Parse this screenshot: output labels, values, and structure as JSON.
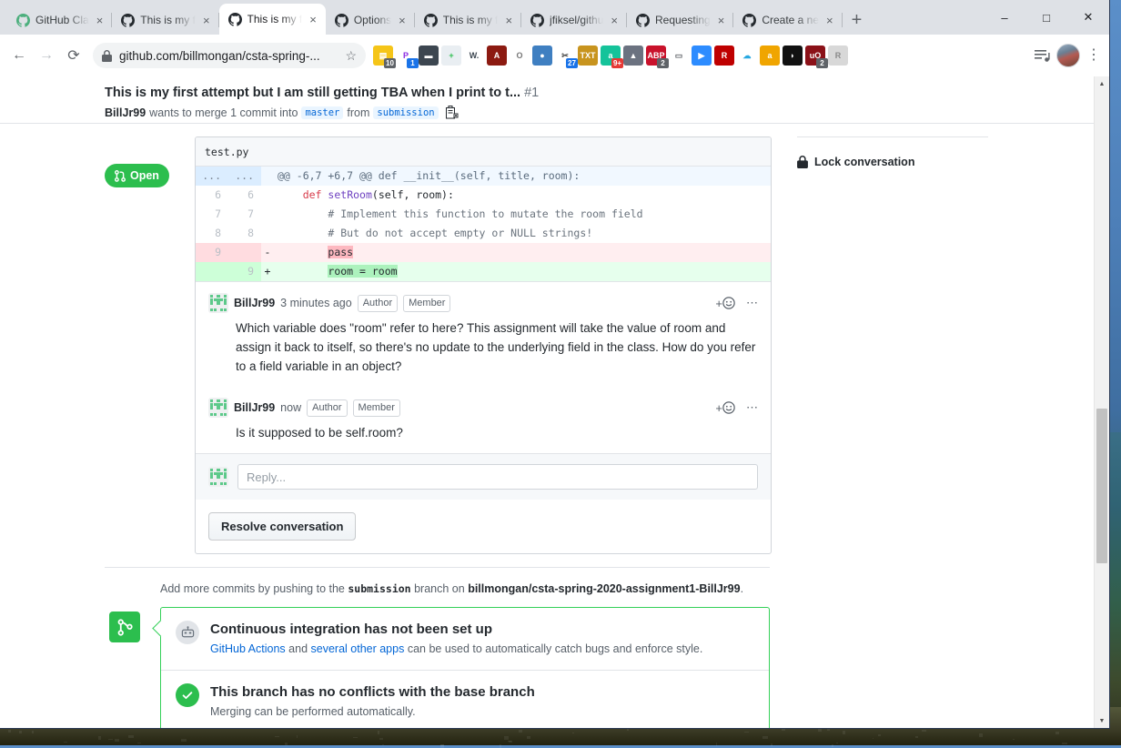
{
  "browser": {
    "tabs": [
      {
        "title": "GitHub Cla",
        "active": false
      },
      {
        "title": "This is my f",
        "active": false
      },
      {
        "title": "This is my f",
        "active": true
      },
      {
        "title": "Options",
        "active": false
      },
      {
        "title": "This is my f",
        "active": false
      },
      {
        "title": "jfiksel/githu",
        "active": false
      },
      {
        "title": "Requesting",
        "active": false
      },
      {
        "title": "Create a ne",
        "active": false
      }
    ],
    "new_tab_label": "+",
    "tab_close_label": "×",
    "window_controls": {
      "minimize": "–",
      "maximize": "□",
      "close": "✕"
    },
    "nav": {
      "back": "←",
      "forward": "→",
      "reload": "⟳"
    },
    "omnibox": {
      "lock_icon": "lock-icon",
      "url": "github.com/billmongan/csta-spring-...",
      "star": "☆"
    },
    "extensions": [
      {
        "name": "notes-extension",
        "glyph": "▤",
        "bg": "#f5c518",
        "badge": "10",
        "badge_color": "gray"
      },
      {
        "name": "pocket-extension",
        "glyph": "P",
        "bg": "#ffffff",
        "fg": "#8a2be2",
        "badge": "1",
        "badge_color": "blue"
      },
      {
        "name": "screenshot-extension",
        "glyph": "▬",
        "bg": "#3c4650",
        "badge": "",
        "badge_color": ""
      },
      {
        "name": "add-page-extension",
        "glyph": "+",
        "bg": "#e9eef2",
        "fg": "#2cbe4e",
        "badge": "",
        "badge_color": ""
      },
      {
        "name": "wikipedia-extension",
        "glyph": "W.",
        "bg": "#ffffff",
        "fg": "#3c4650",
        "badge": "",
        "badge_color": ""
      },
      {
        "name": "adobe-acrobat-extension",
        "glyph": "A",
        "bg": "#8c1a11",
        "badge": "",
        "badge_color": ""
      },
      {
        "name": "opera-extension",
        "glyph": "O",
        "bg": "#ffffff",
        "fg": "#777",
        "badge": "",
        "badge_color": ""
      },
      {
        "name": "globe-extension",
        "glyph": "●",
        "bg": "#3f7fc1",
        "badge": "",
        "badge_color": ""
      },
      {
        "name": "clipper-extension",
        "glyph": "✂",
        "bg": "#ffffff",
        "fg": "#444",
        "badge": "27",
        "badge_color": "blue"
      },
      {
        "name": "txt-extension",
        "glyph": "TXT",
        "bg": "#c8941e",
        "badge": "",
        "badge_color": ""
      },
      {
        "name": "grammar-extension",
        "glyph": "a",
        "bg": "#15c39a",
        "badge": "9+",
        "badge_color": "red"
      },
      {
        "name": "drive-extension",
        "glyph": "▲",
        "bg": "#6b7280",
        "badge": "",
        "badge_color": ""
      },
      {
        "name": "adblock-extension",
        "glyph": "ABP",
        "bg": "#c9122b",
        "badge": "2",
        "badge_color": "gray"
      },
      {
        "name": "cast-extension",
        "glyph": "▭",
        "bg": "#ffffff",
        "fg": "#5f6368",
        "badge": "",
        "badge_color": ""
      },
      {
        "name": "zoom-extension",
        "glyph": "▶",
        "bg": "#2d8cff",
        "badge": "",
        "badge_color": ""
      },
      {
        "name": "rakuten-extension",
        "glyph": "R",
        "bg": "#bf0000",
        "badge": "",
        "badge_color": ""
      },
      {
        "name": "onedrive-extension",
        "glyph": "☁",
        "bg": "#ffffff",
        "fg": "#28a8e0",
        "badge": "",
        "badge_color": ""
      },
      {
        "name": "amazon-extension",
        "glyph": "a",
        "bg": "#f0a500",
        "badge": "",
        "badge_color": ""
      },
      {
        "name": "honey-extension",
        "glyph": "◗",
        "bg": "#111111",
        "badge": "",
        "badge_color": ""
      },
      {
        "name": "ublock-extension",
        "glyph": "uO",
        "bg": "#8b1118",
        "badge": "2",
        "badge_color": "gray"
      },
      {
        "name": "script-extension",
        "glyph": "R",
        "bg": "#d8d8d8",
        "fg": "#8a8a8a",
        "badge": "",
        "badge_color": ""
      }
    ],
    "reading_list_icon": "reading-list-icon",
    "profile_icon": "profile-avatar",
    "menu_icon": "kebab-menu-icon"
  },
  "pull_request": {
    "state_badge": "Open",
    "state_icon": "pull-request-icon",
    "title": "This is my first attempt but I am still getting TBA when I print to t...",
    "number": "#1",
    "meta": {
      "author": "BillJr99",
      "text_before": "wants to merge 1 commit into",
      "base_branch": "master",
      "text_mid": "from",
      "head_branch": "submission",
      "copy_icon": "copy-branch-icon"
    }
  },
  "diff": {
    "filename": "test.py",
    "lines": [
      {
        "type": "hunk",
        "old": "...",
        "new": "...",
        "marker": "",
        "code": "@@ -6,7 +6,7 @@ def __init__(self, title, room):"
      },
      {
        "type": "ctx",
        "old": "6",
        "new": "6",
        "marker": "",
        "code": "    def setRoom(self, room):"
      },
      {
        "type": "ctx",
        "old": "7",
        "new": "7",
        "marker": "",
        "code": "        # Implement this function to mutate the room field"
      },
      {
        "type": "ctx",
        "old": "8",
        "new": "8",
        "marker": "",
        "code": "        # But do not accept empty or NULL strings!"
      },
      {
        "type": "del",
        "old": "9",
        "new": "",
        "marker": "-",
        "code_pre": "        ",
        "code_hl": "pass",
        "code_post": ""
      },
      {
        "type": "add",
        "old": "",
        "new": "9",
        "marker": "+",
        "code_pre": "        ",
        "code_hl": "room = room",
        "code_post": ""
      }
    ]
  },
  "comments": [
    {
      "author": "BillJr99",
      "timestamp": "3 minutes ago",
      "labels": [
        "Author",
        "Member"
      ],
      "body": "Which variable does \"room\" refer to here? This assignment will take the value of room and assign it back to itself, so there's no update to the underlying field in the class. How do you refer to a field variable in an object?",
      "react_icon": "add-reaction-icon",
      "more_icon": "comment-menu-icon"
    },
    {
      "author": "BillJr99",
      "timestamp": "now",
      "labels": [
        "Author",
        "Member"
      ],
      "body": "Is it supposed to be self.room?",
      "react_icon": "add-reaction-icon",
      "more_icon": "comment-menu-icon"
    }
  ],
  "reply": {
    "placeholder": "Reply...",
    "avatar": "user-identicon"
  },
  "resolve_button": "Resolve conversation",
  "push_note": {
    "before": "Add more commits by pushing to the",
    "branch": "submission",
    "middle": "branch on",
    "repo": "billmongan/csta-spring-2020-assignment1-BillJr99",
    "end": "."
  },
  "merge_box": {
    "icon": "git-merge-icon",
    "rows": [
      {
        "icon": "robot-icon",
        "title": "Continuous integration has not been set up",
        "sub_link1": "GitHub Actions",
        "sub_mid": " and ",
        "sub_link2": "several other apps",
        "sub_end": " can be used to automatically catch bugs and enforce style."
      },
      {
        "icon": "check-circle-icon",
        "title": "This branch has no conflicts with the base branch",
        "sub_end": "Merging can be performed automatically."
      }
    ]
  },
  "sidebar": {
    "lock_conversation": "Lock conversation",
    "lock_icon": "lock-icon"
  },
  "scrollbar": {
    "up_arrow": "▲",
    "down_arrow": "▼"
  },
  "colors": {
    "green": "#2cbe4e",
    "blue_link": "#0366d6",
    "diff_add": "#e6ffed",
    "diff_del": "#ffeef0",
    "border": "#e1e4e8"
  }
}
